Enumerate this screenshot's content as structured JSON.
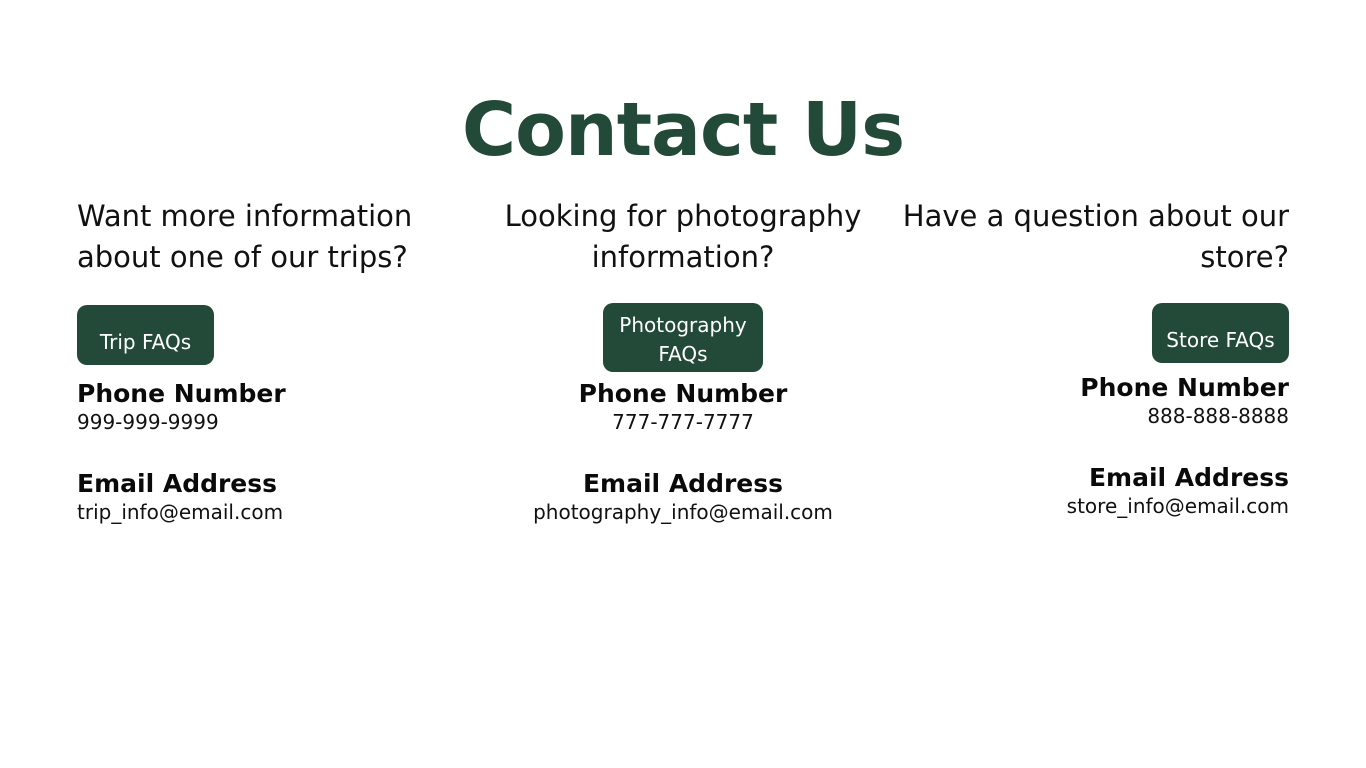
{
  "page": {
    "title": "Contact Us"
  },
  "columns": [
    {
      "question": "Want more information about one of our trips?",
      "button_label": "Trip FAQs",
      "phone_label": "Phone Number",
      "phone_value": "999-999-9999",
      "email_label": "Email Address",
      "email_value": "trip_info@email.com"
    },
    {
      "question": "Looking for photography information?",
      "button_label": "Photography FAQs",
      "phone_label": "Phone Number",
      "phone_value": "777-777-7777",
      "email_label": "Email Address",
      "email_value": "photography_info@email.com"
    },
    {
      "question": "Have a question about our store?",
      "button_label": "Store FAQs",
      "phone_label": "Phone Number",
      "phone_value": "888-888-8888",
      "email_label": "Email Address",
      "email_value": "store_info@email.com"
    }
  ],
  "colors": {
    "accent": "#234a39",
    "background": "#ffffff",
    "text": "#111111"
  }
}
